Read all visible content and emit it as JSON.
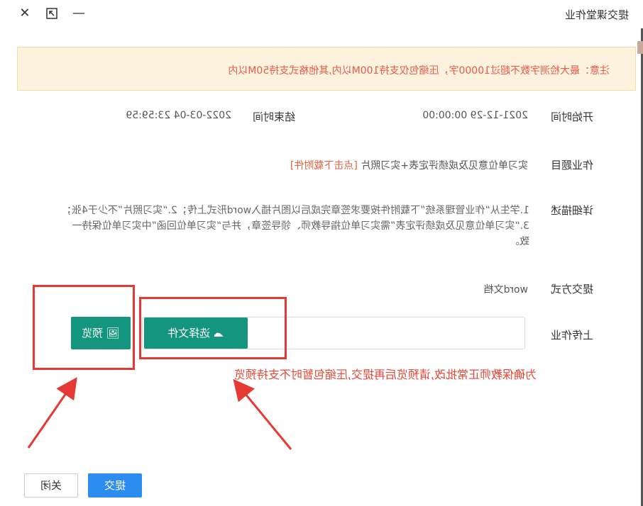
{
  "dialog": {
    "title": "提交课堂作业"
  },
  "notice": {
    "text": "注意：最大检测字数不超过10000字，压缩包仅支持100M以内,其他格式支持50M以内"
  },
  "time": {
    "start_label": "开始时间",
    "start_value": "2021-12-29 00:00:00",
    "end_label": "结束时间",
    "end_value": "2022-03-04 23:59:59"
  },
  "topic": {
    "label": "作业题目",
    "value": "实习单位意见及成绩评定表+实习照片",
    "link_text": "[点击下载附件]"
  },
  "description": {
    "label": "详细描述",
    "text": "1.学生从“作业管理系统”下载附件按要求签章完成后以图片插入word形式上传；2.“实习照片”不少于4张；3.“实习单位意见及成绩评定表”需实习单位指导教师、领导签章，并与“实习单位回函”中实习单位保持一致。"
  },
  "submit_method": {
    "label": "提交方式",
    "value": "word文档"
  },
  "upload": {
    "label": "上传作业",
    "choose_button": "选择文件",
    "preview_button": "预览",
    "hint": "为确保教师正常批改,请预览后再提交,压缩包暂时不支持预览"
  },
  "footer": {
    "submit_button": "提交",
    "close_button": "关闭"
  },
  "colors": {
    "accent_green": "#14957d",
    "primary_blue": "#2d8cf0",
    "warning_red": "#e84535",
    "notice_bg": "#fcf2dd"
  },
  "icons": {
    "close": "close-icon",
    "maximize": "maximize-icon",
    "minimize": "minimize-icon",
    "upload": "cloud-upload-icon",
    "preview": "image-icon"
  }
}
